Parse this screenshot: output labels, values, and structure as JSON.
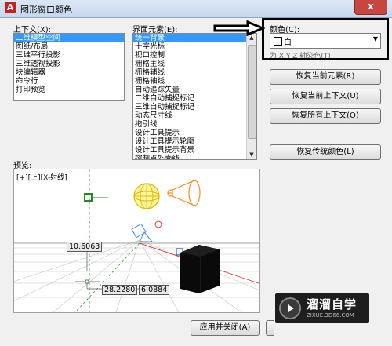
{
  "window": {
    "title": "图形窗口颜色",
    "close_symbol": "x"
  },
  "context": {
    "label": "上下文(X):",
    "items": [
      "二维模型空间",
      "图纸/布局",
      "三维平行投影",
      "三维透视投影",
      "块编辑器",
      "命令行",
      "打印预览"
    ],
    "selected_index": 0
  },
  "interface": {
    "label": "界面元素(E):",
    "items": [
      "统一背景",
      "十字光标",
      "视口控制",
      "栅格主线",
      "栅格辅线",
      "栅格轴线",
      "自动追踪矢量",
      "二维自动捕捉标记",
      "三维自动捕捉标记",
      "动态尺寸线",
      "拖引线",
      "设计工具提示",
      "设计工具提示轮廓",
      "设计工具提示背景",
      "控制点外壳线"
    ],
    "selected_index": 0
  },
  "color": {
    "label": "颜色(C):",
    "value": "白",
    "partial_checkbox_text": "为 X Y Z 轴染色(T)",
    "annotation_arrow_color": "#000000"
  },
  "buttons": {
    "restore_element": "恢复当前元素(R)",
    "restore_context": "恢复当前上下文(U)",
    "restore_all": "恢复所有上下文(O)",
    "restore_classic": "恢复传统颜色(L)",
    "apply_close": "应用并关闭(A)"
  },
  "preview": {
    "label": "预览:",
    "viewport_label": "[+][上][X-射线]",
    "dim_1": "10.6063",
    "dim_2": "28.2280",
    "dim_3": "6.0884"
  },
  "watermark": {
    "title": "溜溜自学",
    "subtitle": "ZIXUE.3D66.COM"
  }
}
